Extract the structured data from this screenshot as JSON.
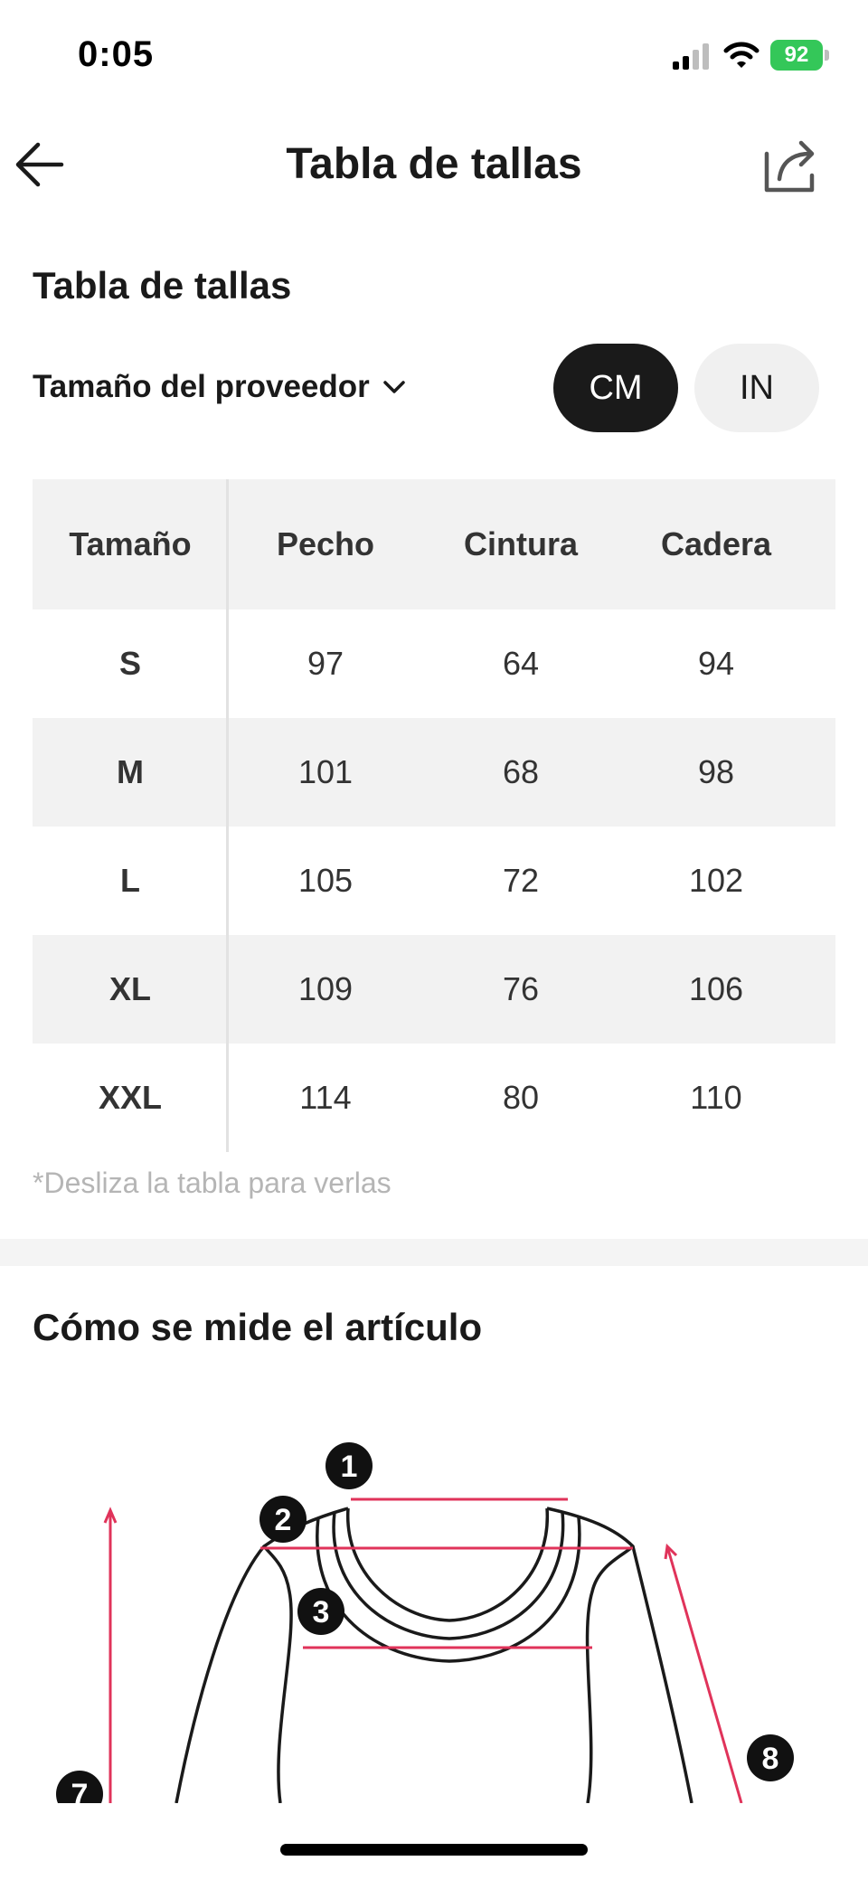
{
  "status_bar": {
    "time": "0:05",
    "battery": "92",
    "icons": [
      "signal-icon",
      "wifi-icon",
      "battery-icon"
    ]
  },
  "nav": {
    "title": "Tabla de tallas",
    "back_icon": "arrow-left-icon",
    "share_icon": "share-icon"
  },
  "size_section": {
    "title": "Tabla de tallas",
    "supplier_label": "Tamaño del proveedor",
    "units": [
      {
        "label": "CM",
        "selected": true
      },
      {
        "label": "IN",
        "selected": false
      }
    ],
    "table": {
      "headers": [
        "Tamaño",
        "Pecho",
        "Cintura",
        "Cadera"
      ],
      "rows": [
        [
          "S",
          "97",
          "64",
          "94"
        ],
        [
          "M",
          "101",
          "68",
          "98"
        ],
        [
          "L",
          "105",
          "72",
          "102"
        ],
        [
          "XL",
          "109",
          "76",
          "106"
        ],
        [
          "XXL",
          "114",
          "80",
          "110"
        ]
      ]
    },
    "hint": "*Desliza la tabla para verlas"
  },
  "measure_section": {
    "title": "Cómo se mide el artículo",
    "markers": [
      "1",
      "2",
      "3",
      "7",
      "8"
    ]
  },
  "colors": {
    "accent_dark": "#1a1a1a",
    "battery_green": "#34c759",
    "measure_line": "#e0335a"
  }
}
